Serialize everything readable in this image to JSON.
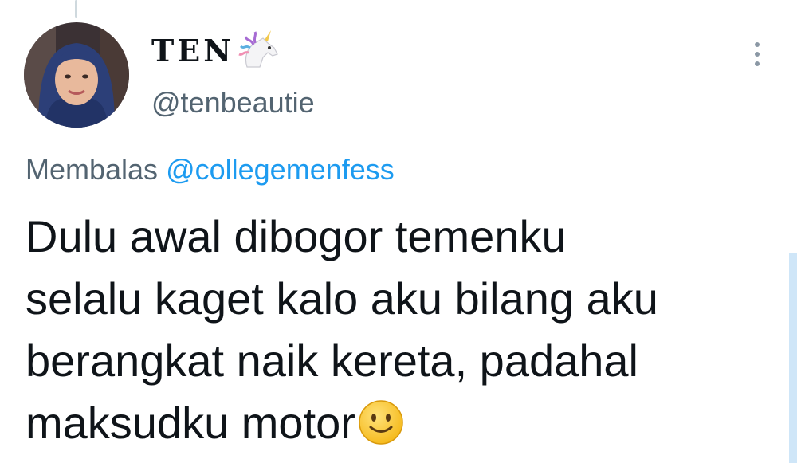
{
  "user": {
    "display_name": "TEN",
    "handle": "@tenbeautie"
  },
  "icons": {
    "name_emoji": "unicorn-icon",
    "more": "more-vertical-icon",
    "text_emoji": "slightly-smiling-face-icon"
  },
  "reply": {
    "prefix": "Membalas",
    "mention": "@collegemenfess"
  },
  "tweet": {
    "lines": [
      "Dulu awal dibogor temenku",
      "selalu kaget kalo aku bilang aku",
      "berangkat naik kereta, padahal",
      "maksudku motor"
    ]
  },
  "colors": {
    "text": "#0f1419",
    "secondary": "#536471",
    "link": "#1d9bf0"
  }
}
